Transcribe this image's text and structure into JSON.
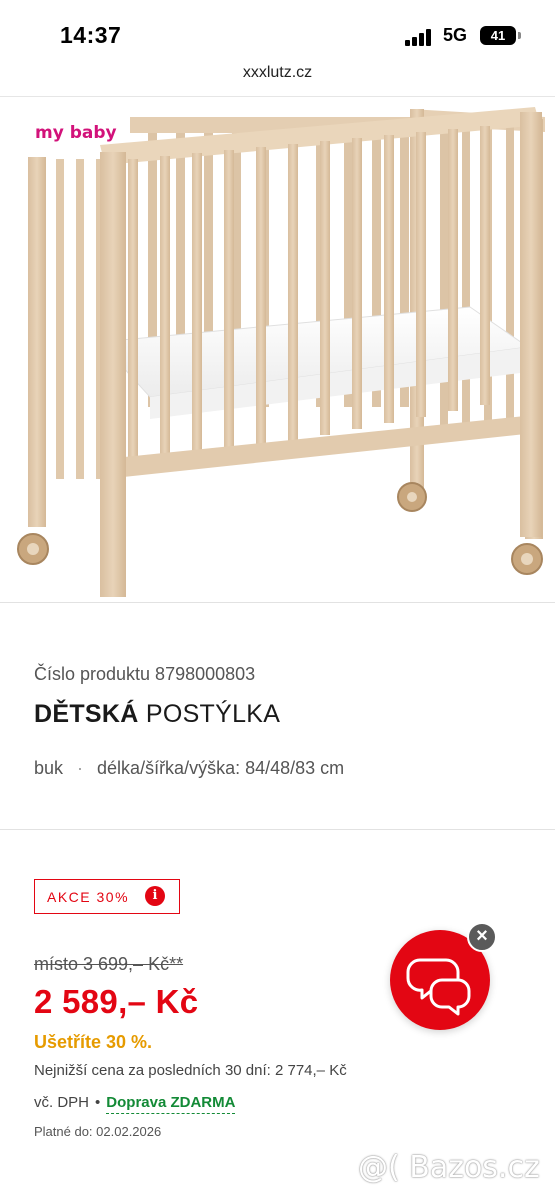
{
  "status_bar": {
    "time": "14:37",
    "network": "5G",
    "battery": "41"
  },
  "browser": {
    "url": "xxxlutz.cz"
  },
  "product_image": {
    "brand_logo": "my baby"
  },
  "product": {
    "number_line": "Číslo produktu 8798000803",
    "title_bold": "DĚTSKÁ",
    "title_regular": "POSTÝLKA",
    "material": "buk",
    "dimensions": "délka/šířka/výška: 84/48/83 cm"
  },
  "promotion": {
    "badge": "AKCE 30%",
    "info_icon": "i"
  },
  "pricing": {
    "old_price": "místo 3 699,– Kč**",
    "new_price": "2 589,– Kč",
    "savings": "Ušetříte 30 %.",
    "lowest_price": "Nejnižší cena za posledních 30 dní: 2 774,– Kč",
    "vat": "vč. DPH",
    "bullet": "•",
    "shipping": "Doprava ZDARMA",
    "valid_until": "Platné do: 02.02.2026"
  },
  "chat": {
    "icon": "chat-bubbles-icon",
    "close_icon": "close-icon"
  },
  "watermark": "@( Bazos.cz",
  "colors": {
    "accent_red": "#e30613",
    "savings_orange": "#e69b00",
    "shipping_green": "#138a36",
    "brand_pink": "#d2127a"
  }
}
